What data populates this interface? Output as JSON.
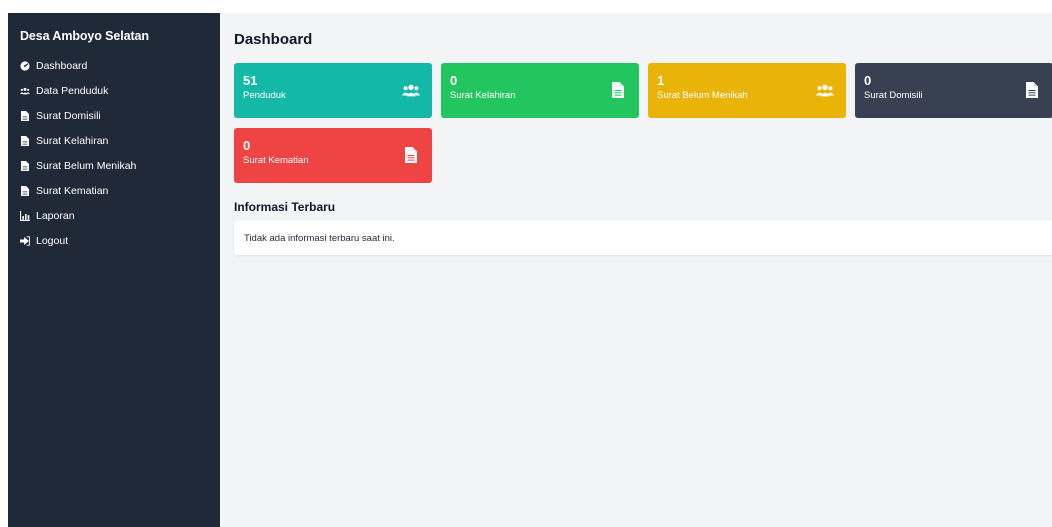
{
  "sidebar": {
    "brand": "Desa Amboyo Selatan",
    "items": [
      {
        "label": "Dashboard",
        "icon": "dashboard-icon"
      },
      {
        "label": "Data Penduduk",
        "icon": "users-icon"
      },
      {
        "label": "Surat Domisili",
        "icon": "file-icon"
      },
      {
        "label": "Surat Kelahiran",
        "icon": "file-icon"
      },
      {
        "label": "Surat Belum Menikah",
        "icon": "file-icon"
      },
      {
        "label": "Surat Kematian",
        "icon": "file-icon"
      },
      {
        "label": "Laporan",
        "icon": "chart-icon"
      },
      {
        "label": "Logout",
        "icon": "logout-icon"
      }
    ]
  },
  "main": {
    "title": "Dashboard",
    "cards": [
      {
        "count": "51",
        "label": "Penduduk",
        "color": "#14b8a6",
        "icon": "users-icon"
      },
      {
        "count": "0",
        "label": "Surat Kelahiran",
        "color": "#22c55e",
        "icon": "file-icon"
      },
      {
        "count": "1",
        "label": "Surat Belum Menikah",
        "color": "#eab308",
        "icon": "users-icon"
      },
      {
        "count": "0",
        "label": "Surat Domisili",
        "color": "#374151",
        "icon": "file-icon"
      },
      {
        "count": "0",
        "label": "Surat Kematian",
        "color": "#ef4444",
        "icon": "file-icon"
      }
    ],
    "info": {
      "title": "Informasi Terbaru",
      "text": "Tidak ada informasi terbaru saat ini."
    }
  },
  "colors": {
    "sidebar_bg": "#1f2937",
    "main_bg": "#f3f4f6"
  }
}
